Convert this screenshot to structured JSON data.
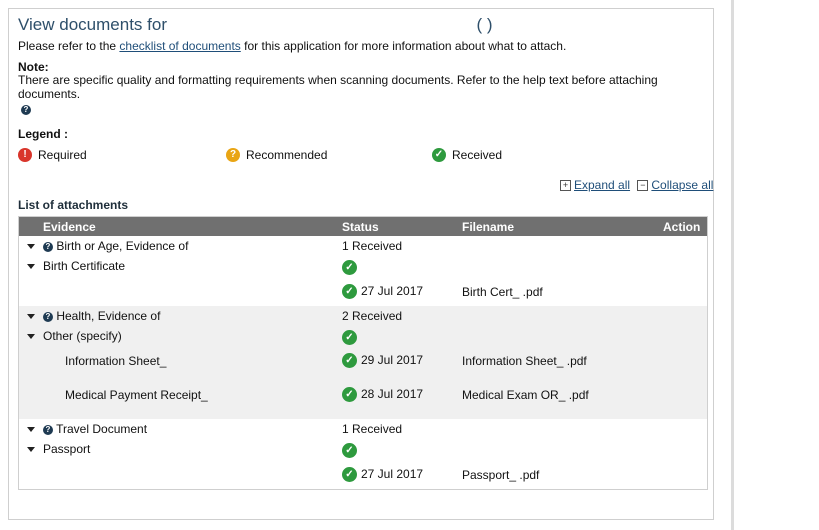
{
  "header": {
    "title_prefix": "View documents for",
    "title_suffix": "( )"
  },
  "intro": {
    "before": "Please refer to the",
    "link": "checklist of documents",
    "after": "for this application for more information about what to attach."
  },
  "note": {
    "heading": "Note:",
    "text": "There are specific quality and formatting requirements when scanning documents. Refer to the help text before attaching documents."
  },
  "legend": {
    "heading": "Legend :",
    "items": [
      {
        "label": "Required",
        "icon": "required-icon",
        "color": "#d9352b"
      },
      {
        "label": "Recommended",
        "icon": "recommended-icon",
        "color": "#e9a514"
      },
      {
        "label": "Received",
        "icon": "received-icon",
        "color": "#2e9a3e"
      }
    ]
  },
  "controls": {
    "expand_all": "Expand all",
    "collapse_all": "Collapse all"
  },
  "attachments": {
    "heading": "List of attachments",
    "columns": {
      "evidence": "Evidence",
      "status": "Status",
      "filename": "Filename",
      "action": "Action"
    },
    "groups": [
      {
        "name": "Birth or Age, Evidence of",
        "status": "1 Received",
        "subtype": "Birth Certificate",
        "files": [
          {
            "name": "",
            "date": "27 Jul 2017",
            "filename": "Birth Cert_ .pdf"
          }
        ]
      },
      {
        "name": "Health, Evidence of",
        "status": "2 Received",
        "subtype": "Other (specify)",
        "files": [
          {
            "name": "Information Sheet_",
            "date": "29 Jul 2017",
            "filename": "Information Sheet_ .pdf"
          },
          {
            "name": "Medical Payment Receipt_",
            "date": "28 Jul 2017",
            "filename": "Medical Exam OR_ .pdf"
          }
        ]
      },
      {
        "name": "Travel Document",
        "status": "1 Received",
        "subtype": "Passport",
        "files": [
          {
            "name": "",
            "date": "27 Jul 2017",
            "filename": "Passport_ .pdf"
          }
        ]
      }
    ]
  }
}
